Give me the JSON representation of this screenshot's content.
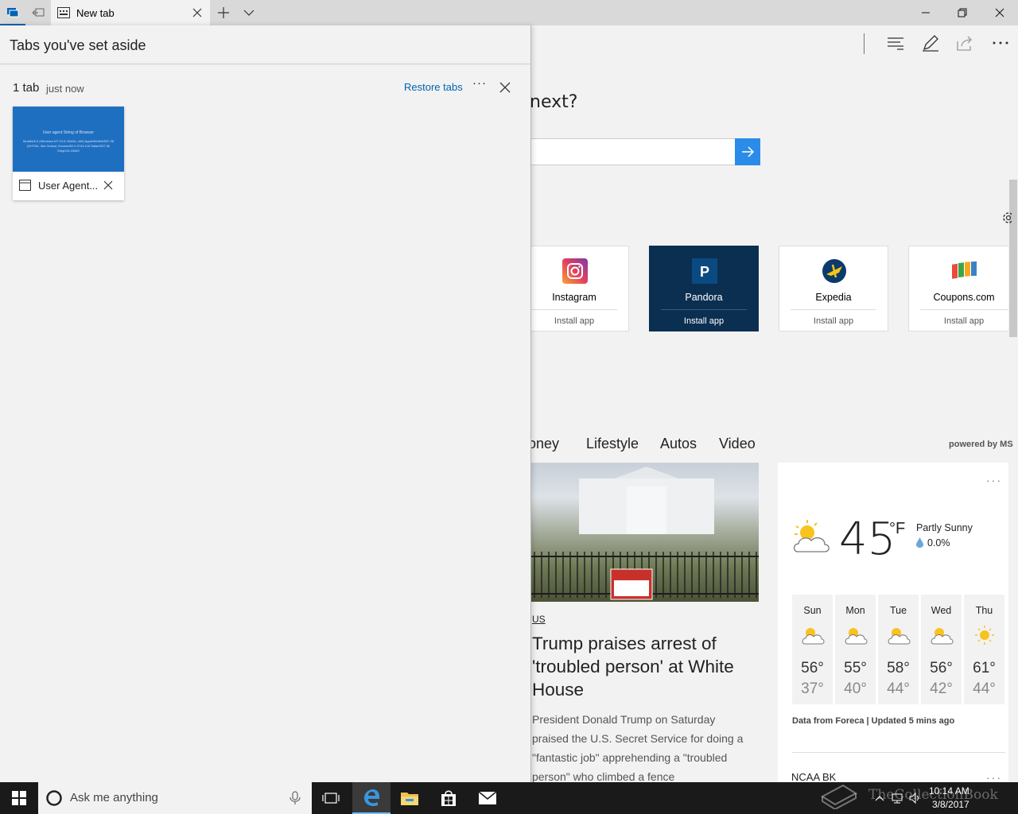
{
  "tabbar": {
    "tab_title": "New tab",
    "new_tab_label": "+"
  },
  "aside": {
    "title": "Tabs you've set aside",
    "group_count": "1 tab",
    "group_time": "just now",
    "restore_label": "Restore tabs",
    "more_label": "···",
    "tab_items": [
      {
        "label": "User Agent...",
        "preview_title": "User agent String of Browser",
        "preview_text": "Mozilla/5.0 (Windows NT 10.0; Win64; x64) AppleWebKit/537.36 (KHTML, like Gecko) Chrome/52.0.2743.116 Safari/537.36 Edge/15.15063"
      }
    ]
  },
  "ntp": {
    "heading": "next?",
    "tiles": [
      {
        "name": "Instagram",
        "action": "Install app",
        "icon": "instagram-icon",
        "color": "#c13584"
      },
      {
        "name": "Pandora",
        "action": "Install app",
        "icon": "pandora-icon",
        "color": "#0b2f51"
      },
      {
        "name": "Expedia",
        "action": "Install app",
        "icon": "expedia-icon",
        "color": "#0b3a6b"
      },
      {
        "name": "Coupons.com",
        "action": "Install app",
        "icon": "coupons-icon",
        "color": "#e8a62c"
      }
    ],
    "news_nav": [
      "loney",
      "Lifestyle",
      "Autos",
      "Video"
    ],
    "powered_by": "powered by MS",
    "article": {
      "category": "US",
      "title": "Trump praises arrest of 'troubled person' at White House",
      "body": "President Donald Trump on Saturday praised the U.S. Secret Service for doing a \"fantastic job\" apprehending a \"troubled person\" who climbed a fence"
    },
    "weather": {
      "temp": "45",
      "unit": "°F",
      "condition": "Partly Sunny",
      "precip": "0.0%",
      "days": [
        {
          "name": "Sun",
          "hi": "56°",
          "lo": "37°",
          "icon": "partly-sunny-icon"
        },
        {
          "name": "Mon",
          "hi": "55°",
          "lo": "40°",
          "icon": "partly-sunny-icon"
        },
        {
          "name": "Tue",
          "hi": "58°",
          "lo": "44°",
          "icon": "partly-sunny-icon"
        },
        {
          "name": "Wed",
          "hi": "56°",
          "lo": "42°",
          "icon": "partly-sunny-icon"
        },
        {
          "name": "Thu",
          "hi": "61°",
          "lo": "44°",
          "icon": "sunny-icon"
        }
      ],
      "source": "Data from Foreca | Updated 5 mins ago",
      "next_card": "NCAA BK"
    }
  },
  "taskbar": {
    "search_placeholder": "Ask me anything",
    "time": "10:14 AM",
    "date": "3/8/2017",
    "watermark": "TheCollectionBook"
  },
  "colors": {
    "accent": "#0063b1",
    "search_button": "#2b8be8",
    "pandora_tile": "#0b2f51",
    "taskbar": "#1a1a1a"
  }
}
